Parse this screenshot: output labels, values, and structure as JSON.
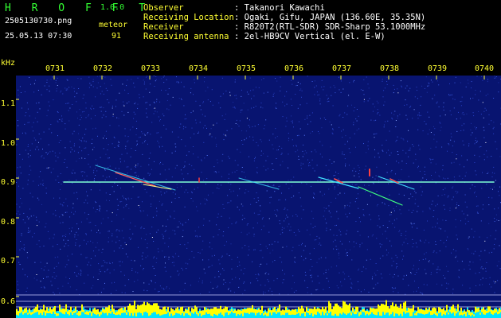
{
  "header": {
    "app_name": "H R O F F T",
    "version": "1.0.0",
    "filename": "2505130730.png",
    "datetime": "25.05.13 07:30",
    "meteor_label": "meteor",
    "meteor_count": "91",
    "info_labels": [
      "Observer",
      "Receiving Location",
      "Receiver",
      "Receiving antenna"
    ],
    "info_values": [
      ": Takanori Kawachi",
      ": Ogaki, Gifu, JAPAN (136.60E, 35.35N)",
      ": R820T2(RTL-SDR) SDR-Sharp 53.1000MHz",
      ": 2el-HB9CV Vertical (el. E-W)"
    ]
  },
  "axes": {
    "y_unit": "kHz",
    "y_ticks": [
      "1.1",
      "1.0",
      "0.9",
      "0.8",
      "0.7",
      "0.6"
    ],
    "x_ticks": [
      "0731",
      "0732",
      "0733",
      "0734",
      "0735",
      "0736",
      "0737",
      "0738",
      "0739",
      "0740"
    ]
  },
  "colors": {
    "background": "#000000",
    "noise": "#1a2c9a",
    "carrier": "#7fffd4",
    "label_yellow": "#ffff33",
    "title_green": "#33ff33",
    "level_cyan": "#00e5ff",
    "level_yellow": "#ffff00"
  }
}
